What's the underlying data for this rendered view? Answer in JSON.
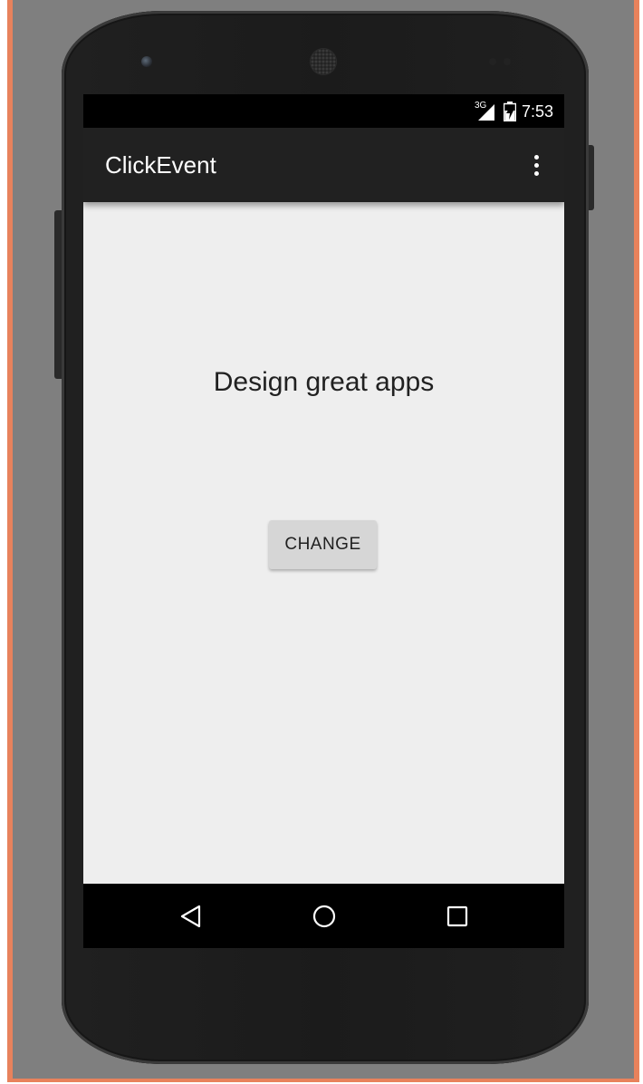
{
  "status_bar": {
    "network": "3G",
    "time": "7:53"
  },
  "app_bar": {
    "title": "ClickEvent"
  },
  "content": {
    "headline": "Design great apps",
    "button_label": "CHANGE"
  },
  "nav_bar": {
    "icons": [
      "back-icon",
      "home-icon",
      "recents-icon"
    ]
  },
  "colors": {
    "frame_border": "#e8825c",
    "backdrop": "#7f7f7f",
    "app_bar": "#212121",
    "screen_background": "#eeeeee",
    "button": "#d6d6d6"
  }
}
